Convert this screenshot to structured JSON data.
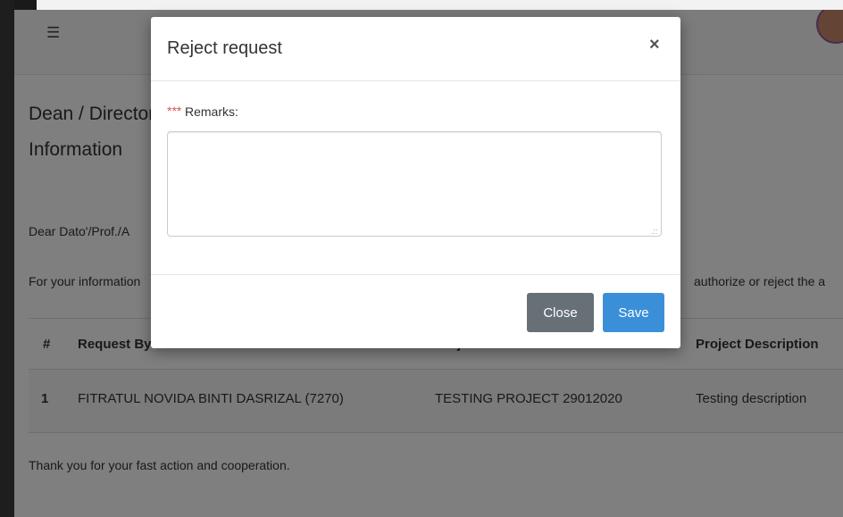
{
  "page": {
    "hamburger": "☰",
    "heading_line1": "Dean / Director",
    "heading_line2": "Information",
    "greeting": "Dear Dato'/Prof./A",
    "info_text": "For your information",
    "info_tail": "authorize or reject the a",
    "thanks": "Thank you for your fast action and cooperation."
  },
  "table": {
    "headers": [
      "#",
      "Request By",
      "Project Title",
      "Project Description"
    ],
    "rows": [
      [
        "1",
        "FITRATUL NOVIDA BINTI DASRIZAL (7270)",
        "TESTING PROJECT 29012020",
        "Testing description"
      ]
    ]
  },
  "modal": {
    "title": "Reject request",
    "close_icon": "×",
    "required_mark": "***",
    "remarks_label": "Remarks:",
    "remarks_value": "",
    "close_label": "Close",
    "save_label": "Save"
  }
}
